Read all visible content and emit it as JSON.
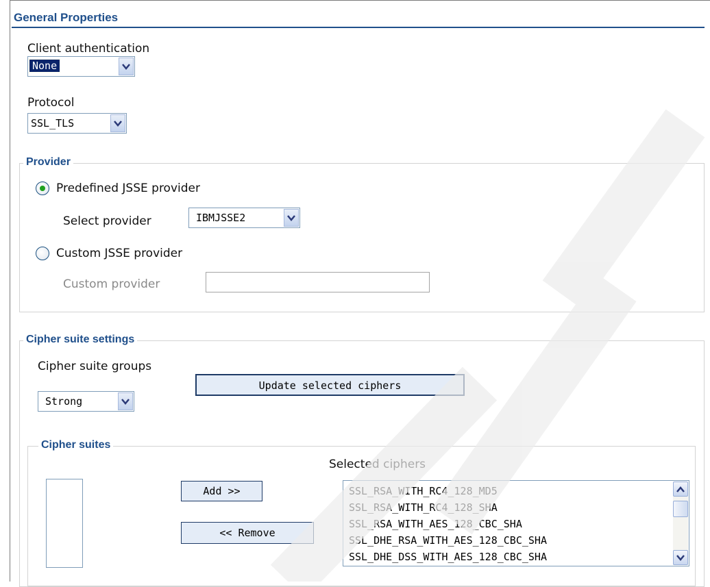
{
  "section": {
    "title": "General Properties"
  },
  "client_auth": {
    "label": "Client authentication",
    "value": "None"
  },
  "protocol": {
    "label": "Protocol",
    "value": "SSL_TLS"
  },
  "provider": {
    "legend": "Provider",
    "predefined_label": "Predefined JSSE provider",
    "predefined_selected": true,
    "select_label": "Select provider",
    "select_value": "IBMJSSE2",
    "custom_label": "Custom JSSE provider",
    "custom_selected": false,
    "custom_field_label": "Custom provider",
    "custom_field_value": ""
  },
  "cipher_settings": {
    "legend": "Cipher suite settings",
    "groups_label": "Cipher suite groups",
    "groups_value": "Strong",
    "update_button": "Update selected ciphers"
  },
  "cipher_suites": {
    "legend": "Cipher suites",
    "add_button": "Add >>",
    "remove_button": "<< Remove",
    "selected_label": "Selected ciphers",
    "selected": [
      "SSL_RSA_WITH_RC4_128_MD5",
      "SSL_RSA_WITH_RC4_128_SHA",
      "SSL_RSA_WITH_AES_128_CBC_SHA",
      "SSL_DHE_RSA_WITH_AES_128_CBC_SHA",
      "SSL_DHE_DSS_WITH_AES_128_CBC_SHA"
    ]
  },
  "icons": {
    "dropdown": "chevron-down-icon",
    "scroll_up": "scroll-up-arrow-icon",
    "scroll_down": "scroll-down-arrow-icon"
  },
  "colors": {
    "section_title": "#1f4f8b",
    "radio_selected": "#21a121",
    "selection_highlight": "#0a246a"
  }
}
